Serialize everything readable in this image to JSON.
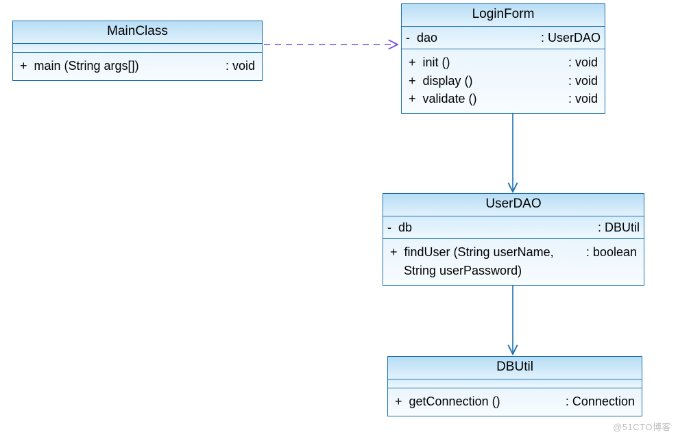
{
  "classes": {
    "main": {
      "name": "MainClass",
      "methods": [
        {
          "sig": "+  main (String args[])",
          "ret": ": void"
        }
      ]
    },
    "login": {
      "name": "LoginForm",
      "attrs": [
        {
          "sig": "-  dao",
          "ret": ": UserDAO"
        }
      ],
      "methods": [
        {
          "sig": "+  init ()        ",
          "ret": ": void"
        },
        {
          "sig": "+  display ()  ",
          "ret": ": void"
        },
        {
          "sig": "+  validate ()",
          "ret": ": void"
        }
      ]
    },
    "userdao": {
      "name": "UserDAO",
      "attrs": [
        {
          "sig": "-  db",
          "ret": ": DBUtil"
        }
      ],
      "methods": [
        {
          "sig": "+  findUser (String userName,",
          "ret": ": boolean"
        },
        {
          "sig": "    String userPassword)",
          "ret": ""
        }
      ]
    },
    "dbutil": {
      "name": "DBUtil",
      "methods": [
        {
          "sig": "+  getConnection ()",
          "ret": ": Connection"
        }
      ]
    }
  },
  "relations": {
    "main_to_login": {
      "type": "dependency",
      "from": "MainClass",
      "to": "LoginForm"
    },
    "login_to_dao": {
      "type": "association",
      "from": "LoginForm",
      "to": "UserDAO"
    },
    "dao_to_dbutil": {
      "type": "association",
      "from": "UserDAO",
      "to": "DBUtil"
    }
  },
  "watermark": "@51CTO博客"
}
